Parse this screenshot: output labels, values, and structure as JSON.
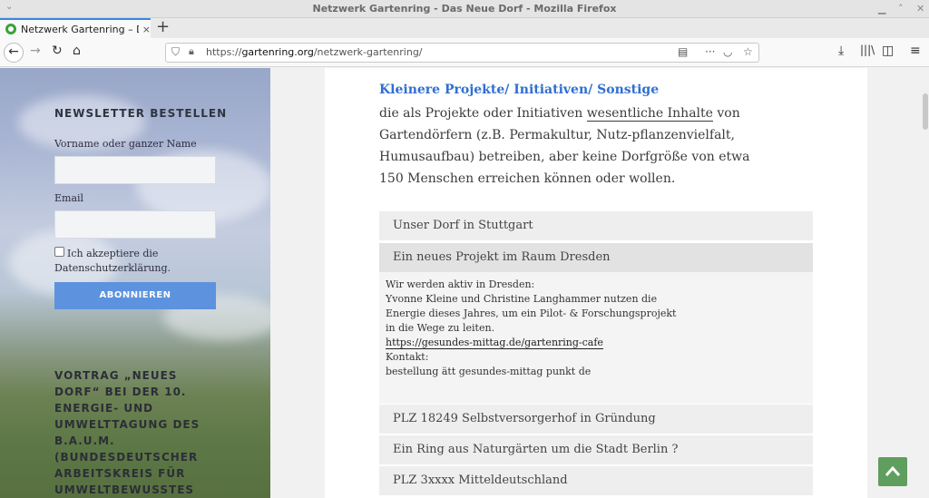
{
  "window": {
    "title": "Netzwerk Gartenring - Das Neue Dorf - Mozilla Firefox"
  },
  "tab": {
    "label": "Netzwerk Gartenring – Das Neue Dorf",
    "close": "×",
    "new_tab": "+"
  },
  "nav": {
    "url_prefix": "https://",
    "url_host": "gartenring.org",
    "url_path": "/netzwerk-gartenring/",
    "more": "···"
  },
  "sidebar": {
    "newsletter_title": "NEWSLETTER BESTELLEN",
    "name_label": "Vorname oder ganzer Name",
    "name_value": "",
    "email_label": "Email",
    "email_value": "",
    "consent_text": "Ich akzeptiere die Datenschutzerklärung.",
    "subscribe_label": "ABONNIEREN",
    "vortrag_title": "VORTRAG „NEUES DORF“ BEI DER 10. ENERGIE- UND UMWELTTAGUNG DES B.A.U.M. (BUNDESDEUTSCHER ARBEITSKREIS FÜR UMWELTBEWUSSTES MANAGEMENT E.V.)"
  },
  "content": {
    "heading": "Kleinere Projekte/ Initiativen/ Sonstige",
    "intro_before": "die als Projekte oder Initiativen ",
    "intro_link": "wesentliche Inhalte",
    "intro_after": " von Gartendörfern (z.B. Permakultur, Nutz-pflanzenvielfalt, Humusaufbau) betreiben, aber keine Dorfgröße von etwa 150 Menschen erreichen können oder wollen.",
    "accordion": [
      {
        "title": "Unser Dorf in Stuttgart"
      },
      {
        "title": "Ein neues Projekt im Raum Dresden"
      },
      {
        "title": "PLZ 18249 Selbstversorgerhof in Gründung"
      },
      {
        "title": "Ein Ring aus Naturgärten um die Stadt Berlin ?"
      },
      {
        "title": "PLZ 3xxxx Mitteldeutschland"
      }
    ],
    "dresden_body": {
      "line1": "Wir werden aktiv in Dresden:",
      "line2": "Yvonne Kleine und Christine Langhammer nutzen die",
      "line3": "Energie dieses Jahres, um ein Pilot- & Forschungsprojekt",
      "line4": "in die Wege zu leiten.",
      "link": "https://gesundes-mittag.de/gartenring-cafe",
      "line5": "Kontakt:",
      "line6": "bestellung ätt gesundes-mittag punkt de"
    }
  },
  "colors": {
    "accent": "#2f6fd1",
    "button": "#5d92de",
    "totop": "#5e9e5e"
  }
}
